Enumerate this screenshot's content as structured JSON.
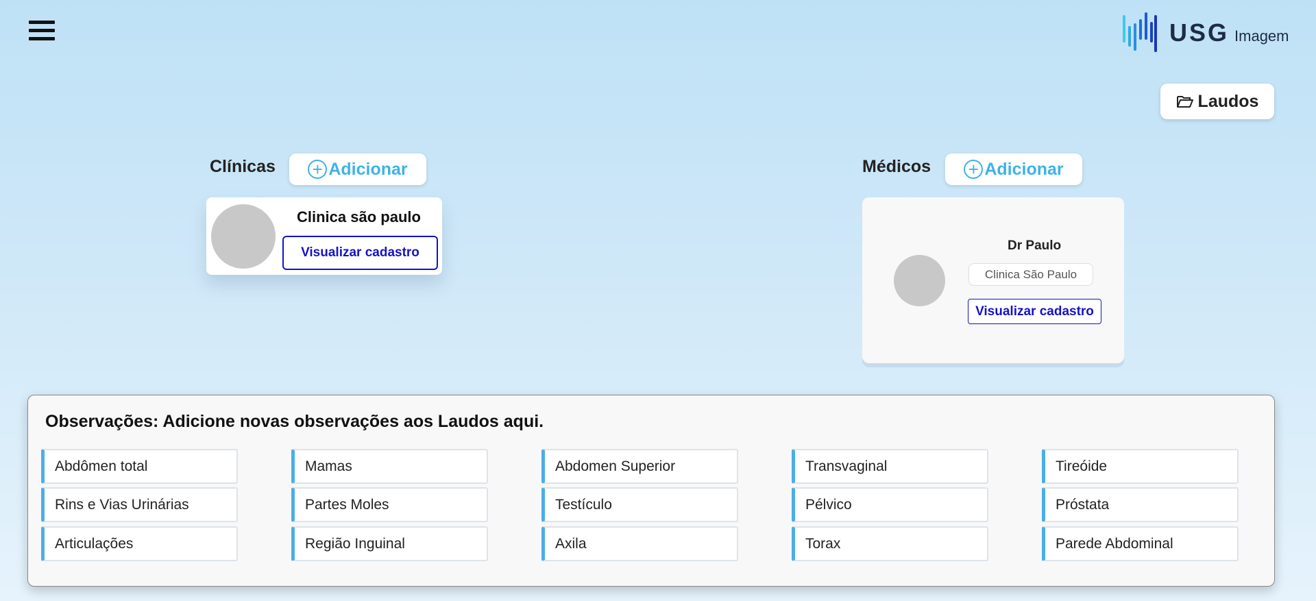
{
  "header": {
    "logo_text": "USG",
    "logo_subtext": "Imagem",
    "laudos_label": "Laudos"
  },
  "colors": {
    "accent": "#3eb3e6",
    "link": "#1412c8",
    "obs_border": "#4aaee8"
  },
  "icons": {
    "menu": "hamburger-icon",
    "folder": "folder-open-icon",
    "add": "plus-circle-icon"
  },
  "clinicas": {
    "title": "Clínicas",
    "add_label": "Adicionar",
    "cards": [
      {
        "name": "Clinica são paulo",
        "view_label": "Visualizar cadastro"
      }
    ]
  },
  "medicos": {
    "title": "Médicos",
    "add_label": "Adicionar",
    "cards": [
      {
        "name": "Dr Paulo",
        "clinic": "Clinica São Paulo",
        "view_label": "Visualizar cadastro"
      }
    ]
  },
  "observacoes": {
    "title": "Observações: Adicione novas observações aos Laudos aqui.",
    "items": [
      "Abdômen total",
      "Mamas",
      "Abdomen Superior",
      "Transvaginal",
      "Tireóide",
      "Rins e Vias Urinárias",
      "Partes Moles",
      "Testículo",
      "Pélvico",
      "Próstata",
      "Articulações",
      "Região Inguinal",
      "Axila",
      "Torax",
      "Parede Abdominal"
    ]
  }
}
